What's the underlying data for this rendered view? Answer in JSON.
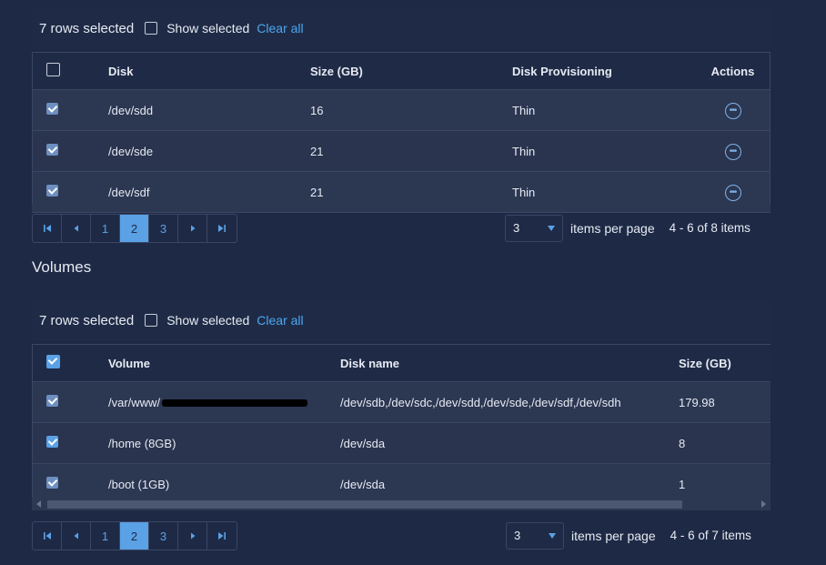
{
  "disks": {
    "selection": {
      "count_text": "7 rows selected",
      "show_selected_label": "Show selected",
      "clear_all_label": "Clear all"
    },
    "columns": [
      "Disk",
      "Size (GB)",
      "Disk Provisioning",
      "Actions"
    ],
    "rows": [
      {
        "disk": "/dev/sdd",
        "size": "16",
        "provisioning": "Thin"
      },
      {
        "disk": "/dev/sde",
        "size": "21",
        "provisioning": "Thin"
      },
      {
        "disk": "/dev/sdf",
        "size": "21",
        "provisioning": "Thin"
      }
    ],
    "pager": {
      "pages": [
        "1",
        "2",
        "3"
      ],
      "active_page": "2"
    },
    "items_per_page": {
      "value": "3",
      "label": "items per page",
      "info": "4 - 6 of 8 items"
    }
  },
  "volumes": {
    "section_title": "Volumes",
    "selection": {
      "count_text": "7 rows selected",
      "show_selected_label": "Show selected",
      "clear_all_label": "Clear all"
    },
    "columns": [
      "Volume",
      "Disk name",
      "Size (GB)"
    ],
    "rows": [
      {
        "volume": "/var/www/",
        "disk_name": "/dev/sdb,/dev/sdc,/dev/sdd,/dev/sde,/dev/sdf,/dev/sdh",
        "size": "179.98"
      },
      {
        "volume": "/home (8GB)",
        "disk_name": "/dev/sda",
        "size": "8"
      },
      {
        "volume": "/boot (1GB)",
        "disk_name": "/dev/sda",
        "size": "1"
      }
    ],
    "pager": {
      "pages": [
        "1",
        "2",
        "3"
      ],
      "active_page": "2"
    },
    "items_per_page": {
      "value": "3",
      "label": "items per page",
      "info": "4 - 6 of 7 items"
    }
  },
  "colors": {
    "background": "#1e2a45",
    "accent": "#5aa1e6",
    "row": "#2c3752"
  }
}
